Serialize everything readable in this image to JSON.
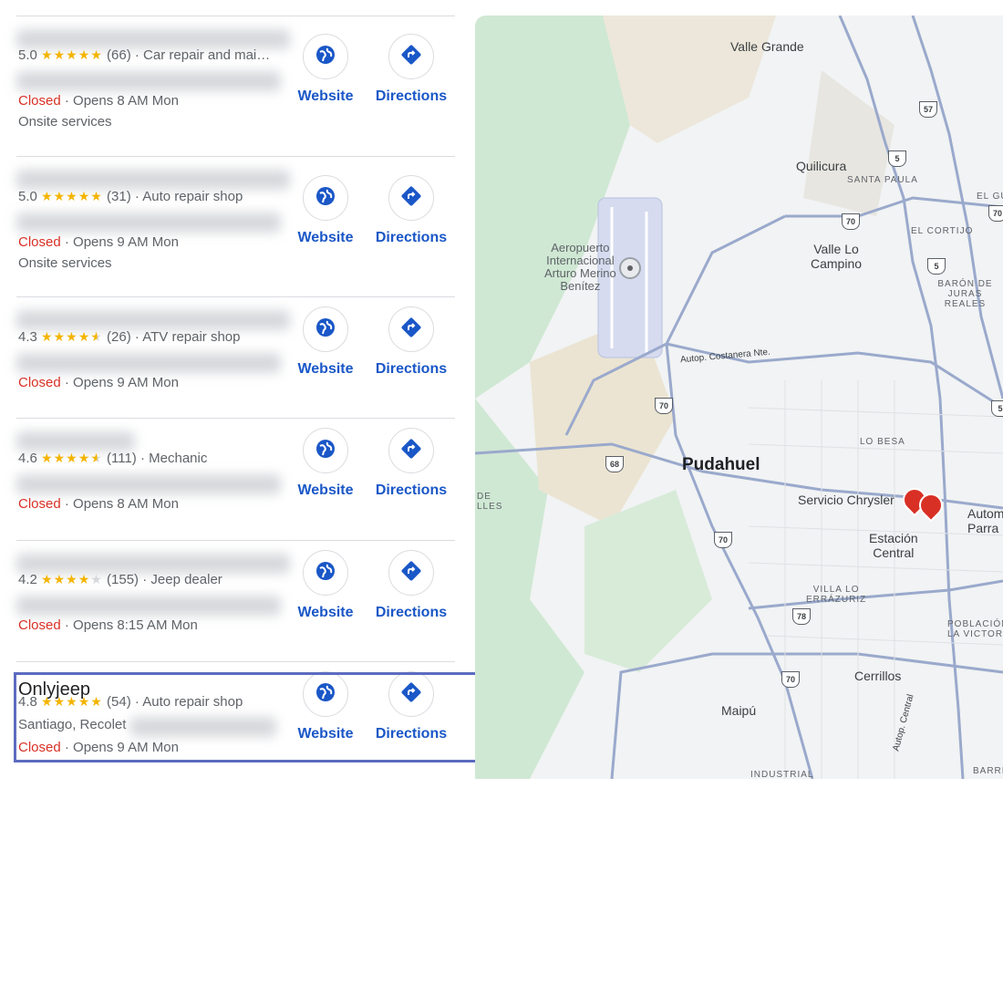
{
  "results": [
    {
      "name": "",
      "rating": "5.0",
      "stars": [
        1,
        1,
        1,
        1,
        1
      ],
      "reviews": "(66)",
      "category": "Car repair and mai…",
      "closed": "Closed",
      "opens": "· Opens 8 AM Mon",
      "extra": "Onsite services",
      "address": ""
    },
    {
      "name": "",
      "rating": "5.0",
      "stars": [
        1,
        1,
        1,
        1,
        1
      ],
      "reviews": "(31)",
      "category": "Auto repair shop",
      "closed": "Closed",
      "opens": "· Opens 9 AM Mon",
      "extra": "Onsite services",
      "address": ""
    },
    {
      "name": "",
      "rating": "4.3",
      "stars": [
        1,
        1,
        1,
        1,
        0.5
      ],
      "reviews": "(26)",
      "category": "ATV repair shop",
      "closed": "Closed",
      "opens": "· Opens 9 AM Mon",
      "extra": "",
      "address": ""
    },
    {
      "name": "",
      "rating": "4.6",
      "stars": [
        1,
        1,
        1,
        1,
        0.5
      ],
      "reviews": "(111)",
      "category": "Mechanic",
      "closed": "Closed",
      "opens": "· Opens 8 AM Mon",
      "extra": "",
      "address": ""
    },
    {
      "name": "",
      "rating": "4.2",
      "stars": [
        1,
        1,
        1,
        1,
        0
      ],
      "reviews": "(155)",
      "category": "Jeep dealer",
      "closed": "Closed",
      "opens": "· Opens 8:15 AM Mon",
      "extra": "",
      "address": ""
    },
    {
      "name": "Onlyjeep",
      "rating": "4.8",
      "stars": [
        1,
        1,
        1,
        1,
        1
      ],
      "reviews": "(54)",
      "category": "Auto repair shop",
      "closed": "Closed",
      "opens": "· Opens 9 AM Mon",
      "extra": "",
      "address": "Santiago, Recolet"
    }
  ],
  "actions": {
    "website": "Website",
    "directions": "Directions"
  },
  "map": {
    "labels": {
      "valle_grande": "Valle Grande",
      "quilicura": "Quilicura",
      "santa_paula": "SANTA PAULA",
      "el_gu": "EL GU",
      "el_cortijo": "EL CORTIJO",
      "valle_lo_campino": "Valle Lo\nCampino",
      "baron": "BARÓN DE\nJURAS REALES",
      "aeropuerto": "Aeropuerto\nInternacional\nArturo Merino\nBenítez",
      "costanera": "Autop. Costanera Nte.",
      "lo_besa": "LO BESA",
      "pudahuel": "Pudahuel",
      "lles": "DE\nLLES",
      "servicio_chrysler": "Servicio Chrysler",
      "autom": "Autom\nParra",
      "estacion_central": "Estación\nCentral",
      "villa_lo_errazuriz": "VILLA LO\nERRÁZURIZ",
      "poblacion": "POBLACIÓN\nLA VICTORI",
      "cerrillos": "Cerrillos",
      "maipu": "Maipú",
      "industrial": "INDUSTRIAL",
      "barri": "BARRI",
      "autop_central": "Autop. Central"
    },
    "shields": {
      "r57": "57",
      "r5a": "5",
      "r70a": "70",
      "r5b": "5",
      "r70b": "70",
      "r68": "68",
      "r70c": "70",
      "r78": "78",
      "r70d": "70",
      "r70e": "70",
      "r5c": "5"
    },
    "colors": {
      "pin": "#d93025",
      "road": "#9aa9cc",
      "highlight": "#5c6bc0",
      "link": "#1a57c7"
    }
  }
}
